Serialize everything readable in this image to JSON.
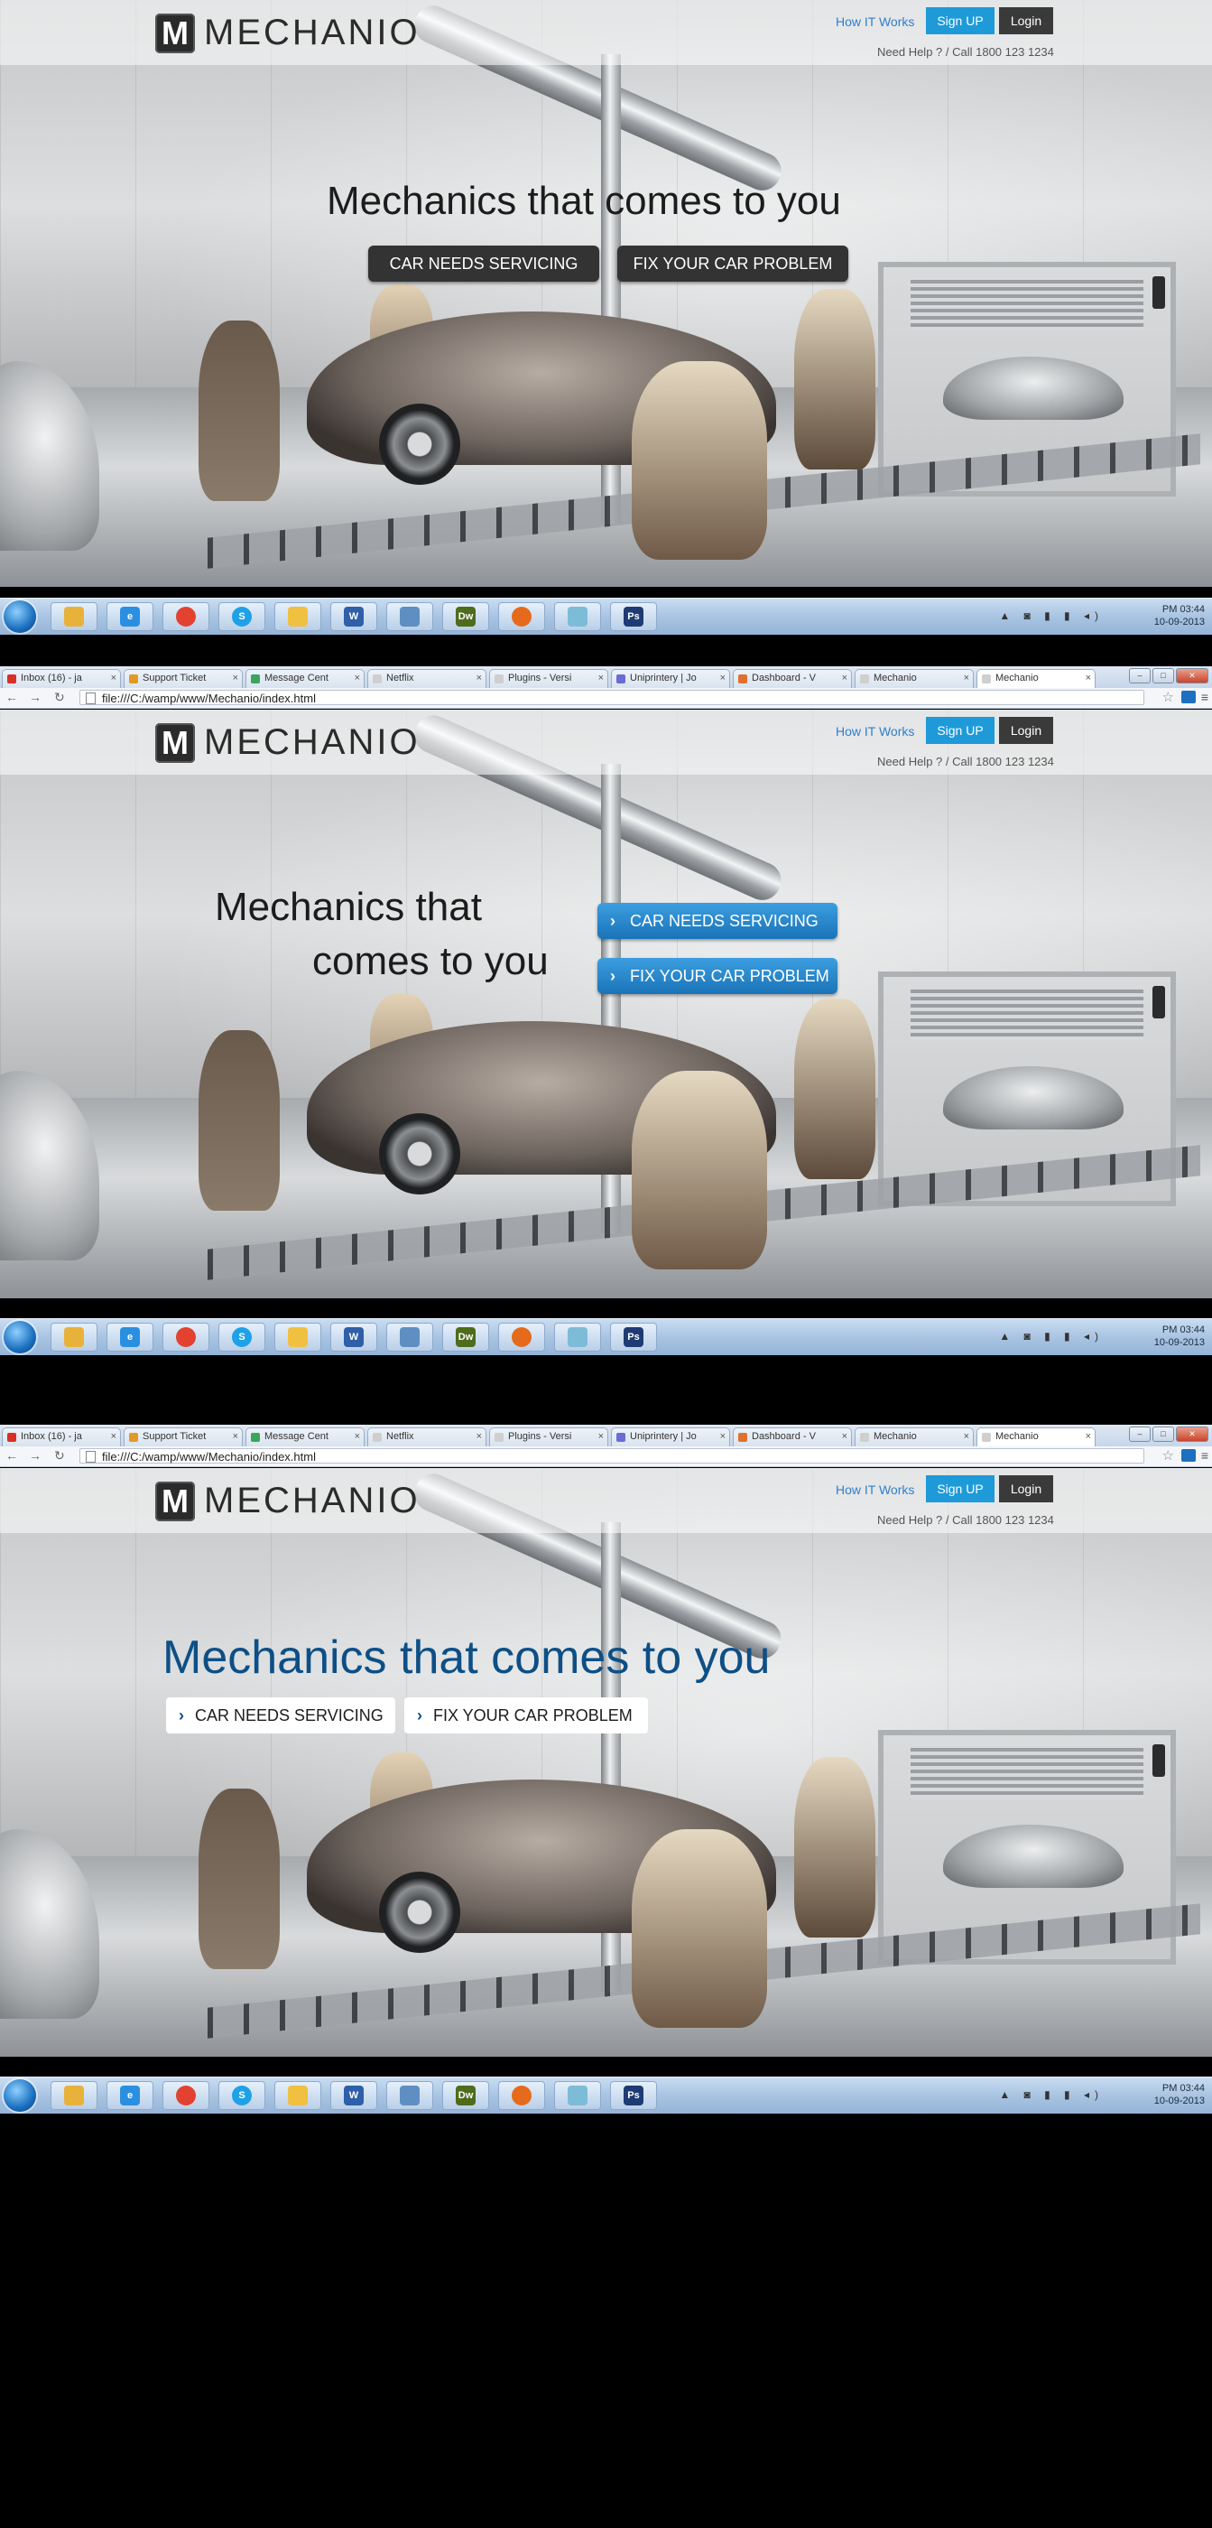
{
  "browser": {
    "tabs": [
      {
        "label": "Inbox (16) - ja",
        "color": "#d93025"
      },
      {
        "label": "Support Ticket",
        "color": "#e39a24"
      },
      {
        "label": "Message Cent",
        "color": "#3aa55d"
      },
      {
        "label": "Netflix",
        "color": "#cfcfcf"
      },
      {
        "label": "Plugins - Versi",
        "color": "#cfcfcf"
      },
      {
        "label": "Uniprintery | Jo",
        "color": "#6b6bd6"
      },
      {
        "label": "Dashboard - V",
        "color": "#e0712f"
      },
      {
        "label": "Mechanio",
        "color": "#cfcfcf"
      },
      {
        "label": "Mechanio",
        "color": "#cfcfcf"
      }
    ],
    "url": "file:///C:/wamp/www/Mechanio/index.html",
    "window_controls": {
      "minimize": "–",
      "maximize": "□",
      "close": "✕"
    }
  },
  "site": {
    "logo_letter": "M",
    "logo_text": "MECHANIO",
    "nav": {
      "how": "How IT Works",
      "signup": "Sign UP",
      "login": "Login"
    },
    "help": "Need Help ? / Call 1800 123 1234"
  },
  "variants": [
    {
      "headline": "Mechanics that comes to you",
      "headline_line1": "Mechanics that",
      "headline_line2": "comes to you",
      "btn1": "CAR NEEDS SERVICING",
      "btn2": "FIX YOUR CAR PROBLEM"
    }
  ],
  "taskbar": {
    "clock_time": "PM 03:44",
    "clock_date": "10-09-2013",
    "icons": [
      {
        "name": "folder-icon",
        "label": "",
        "color": "#e8b23a"
      },
      {
        "name": "ie-icon",
        "label": "e",
        "color": "#2b8fe0"
      },
      {
        "name": "chrome-icon",
        "label": "",
        "color": "#e2422f"
      },
      {
        "name": "skype-icon",
        "label": "S",
        "color": "#1ea1e6"
      },
      {
        "name": "mail-icon",
        "label": "",
        "color": "#f0c040"
      },
      {
        "name": "word-icon",
        "label": "W",
        "color": "#2e5fa8"
      },
      {
        "name": "picture-icon",
        "label": "",
        "color": "#5f8fc2"
      },
      {
        "name": "dreamweaver-icon",
        "label": "Dw",
        "color": "#4f6b1c"
      },
      {
        "name": "firefox-icon",
        "label": "",
        "color": "#e66a1c"
      },
      {
        "name": "app-icon",
        "label": "",
        "color": "#7dbcd6"
      },
      {
        "name": "photoshop-icon",
        "label": "Ps",
        "color": "#1f3b74"
      }
    ],
    "tray": "▲ ◙ ▮ ▮ ◂)"
  }
}
